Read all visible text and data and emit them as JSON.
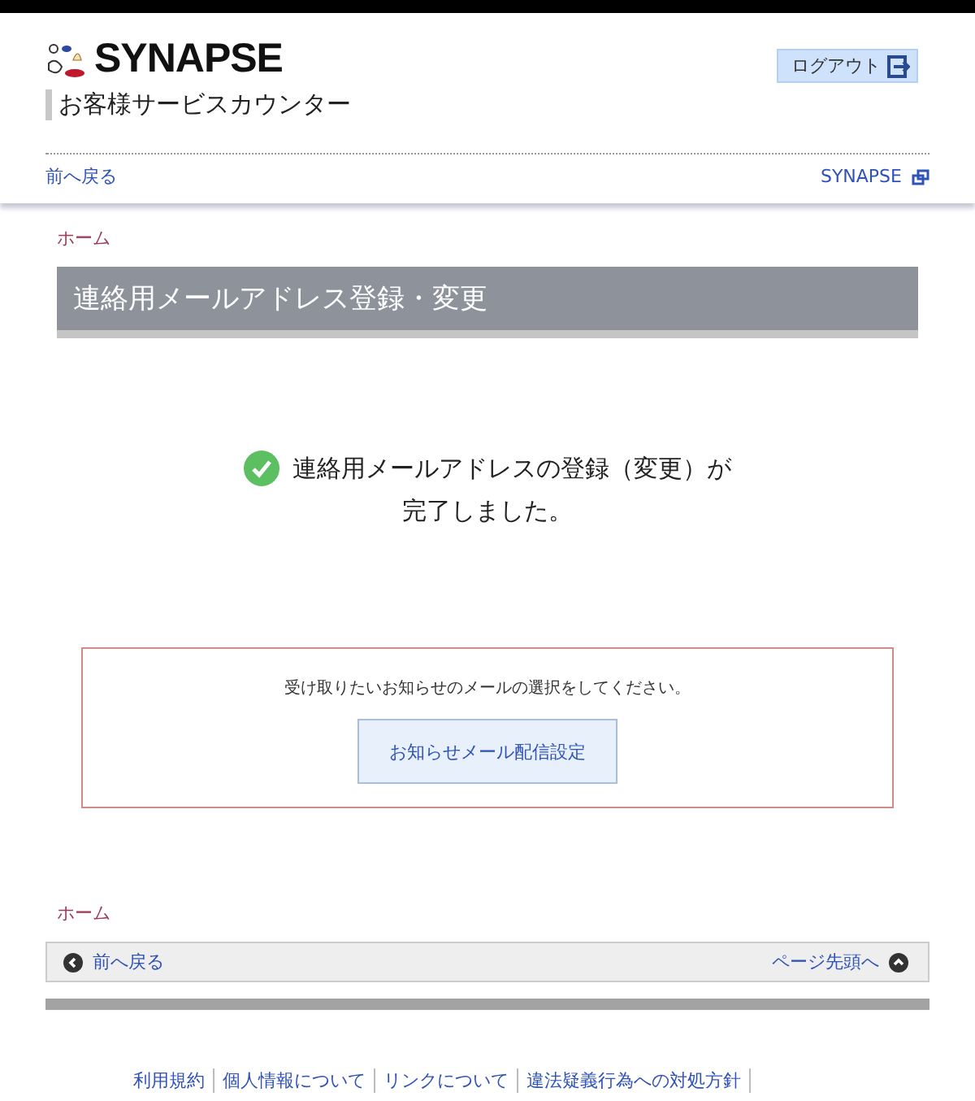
{
  "header": {
    "logo_text": "SYNAPSE",
    "subtitle": "お客様サービスカウンター",
    "logout": "ログアウト",
    "back": "前へ戻る",
    "site_link": "SYNAPSE"
  },
  "breadcrumb_top": "ホーム",
  "title": "連絡用メールアドレス登録・変更",
  "message": {
    "line1": "連絡用メールアドレスの登録（変更）が",
    "line2": "完了しました。"
  },
  "notice": {
    "text": "受け取りたいお知らせのメールの選択をしてください。",
    "button": "お知らせメール配信設定"
  },
  "breadcrumb_bottom": "ホーム",
  "footer_nav": {
    "back": "前へ戻る",
    "top": "ページ先頭へ"
  },
  "footer_links": [
    [
      "利用規約",
      "個人情報について",
      "リンクについて",
      "違法疑義行為への対処方針"
    ]
  ]
}
